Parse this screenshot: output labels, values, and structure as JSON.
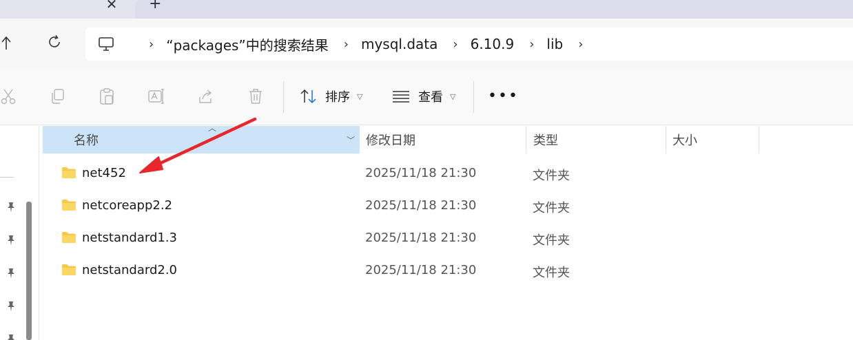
{
  "tabs": {
    "close_glyph": "✕",
    "new_tab_glyph": "+"
  },
  "nav": {
    "up_icon": "arrow-up-icon",
    "refresh_icon": "refresh-icon"
  },
  "breadcrumb": [
    "“packages”中的搜索结果",
    "mysql.data",
    "6.10.9",
    "lib"
  ],
  "toolbar": {
    "sort_label": "排序",
    "view_label": "查看",
    "more_label": "•••"
  },
  "columns": {
    "name": "名称",
    "date": "修改日期",
    "type": "类型",
    "size": "大小"
  },
  "files": [
    {
      "name": "net452",
      "date": "2025/11/18 21:30",
      "type": "文件夹"
    },
    {
      "name": "netcoreapp2.2",
      "date": "2025/11/18 21:30",
      "type": "文件夹"
    },
    {
      "name": "netstandard1.3",
      "date": "2025/11/18 21:30",
      "type": "文件夹"
    },
    {
      "name": "netstandard2.0",
      "date": "2025/11/18 21:30",
      "type": "文件夹"
    }
  ],
  "colors": {
    "accent_header": "#cce4f7",
    "folder": "#f7c948",
    "annotation_arrow": "#e8262b"
  }
}
